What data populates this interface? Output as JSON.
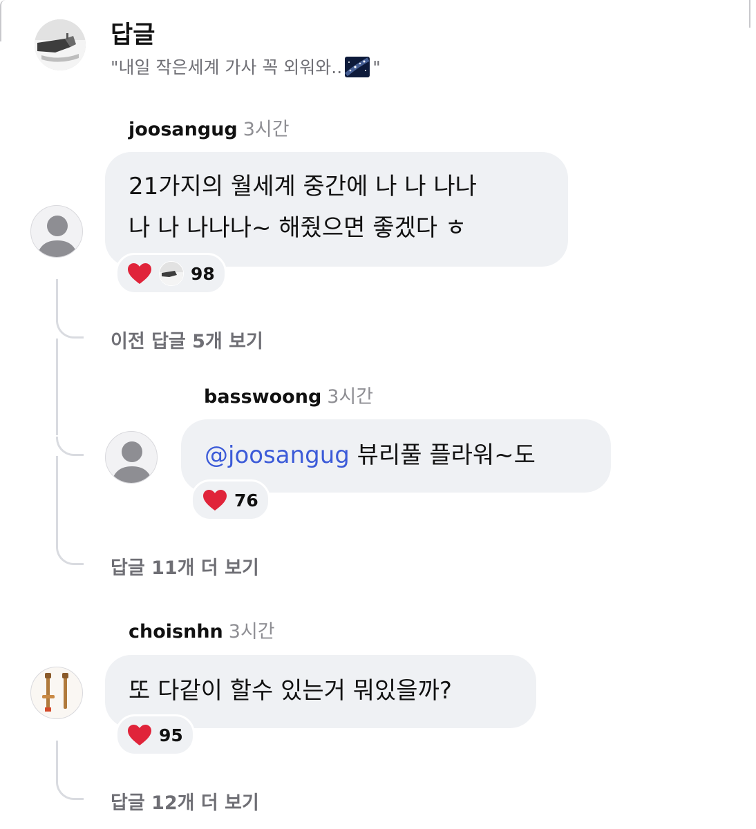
{
  "header": {
    "title": "답글",
    "quote_open": "\"내일 작은세계 가사 꼭 외워와..",
    "quote_close": "\"",
    "quote_emoji": "milky-way-emoji"
  },
  "comments": [
    {
      "username": "joosangug",
      "time": "3시간",
      "text_line1": "21가지의 월세계 중간에 나 나 나나",
      "text_line2": "나 나 나나나~ 해줬으면 좋겠다 ㅎ",
      "reaction_icon": "heart-icon",
      "reaction_count": "98"
    },
    {
      "username": "basswoong",
      "time": "3시간",
      "mention": "@joosangug",
      "text": " 뷰리풀 플라워~도",
      "reaction_icon": "heart-icon",
      "reaction_count": "76"
    },
    {
      "username": "choisnhn",
      "time": "3시간",
      "text": "또 다같이 할수 있는거 뭐있을까?",
      "reaction_icon": "heart-icon",
      "reaction_count": "95"
    }
  ],
  "links": {
    "prev_replies": "이전 답글 5개 보기",
    "more_replies_1": "답글 11개 더 보기",
    "more_replies_2": "답글 12개 더 보기"
  },
  "colors": {
    "bubble": "#eff1f4",
    "mention": "#3c5bd8",
    "secondary_text": "#6f6f75",
    "heart": "#e0243a"
  }
}
